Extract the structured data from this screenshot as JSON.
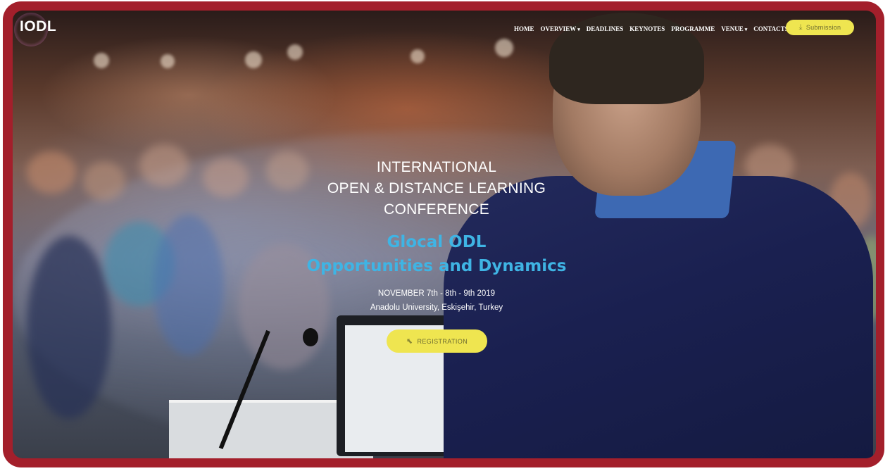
{
  "brand": {
    "logo_text": "IODL"
  },
  "nav": {
    "items": [
      {
        "label": "HOME",
        "dropdown": false
      },
      {
        "label": "OVERVIEW",
        "dropdown": true
      },
      {
        "label": "DEADLINES",
        "dropdown": false
      },
      {
        "label": "KEYNOTES",
        "dropdown": false
      },
      {
        "label": "PROGRAMME",
        "dropdown": false
      },
      {
        "label": "VENUE",
        "dropdown": true
      },
      {
        "label": "CONTACTS",
        "dropdown": false
      }
    ],
    "submission_label": "Submission",
    "submission_icon": "download-icon"
  },
  "hero": {
    "title_lines": [
      "INTERNATIONAL",
      "OPEN & DISTANCE LEARNING",
      "CONFERENCE"
    ],
    "subtitle_lines": [
      "Glocal ODL",
      "Opportunities and Dynamics"
    ],
    "date": "NOVEMBER 7th - 8th - 9th 2019",
    "location": "Anadolu University, Eskişehir, Turkey",
    "registration_label": "REGISTRATION",
    "registration_icon": "cursor-click-icon"
  },
  "colors": {
    "frame": "#a31f2b",
    "accent_yellow": "#efe550",
    "subtitle_blue": "#3fb4e4",
    "speaker_suit": "#1f2655"
  }
}
